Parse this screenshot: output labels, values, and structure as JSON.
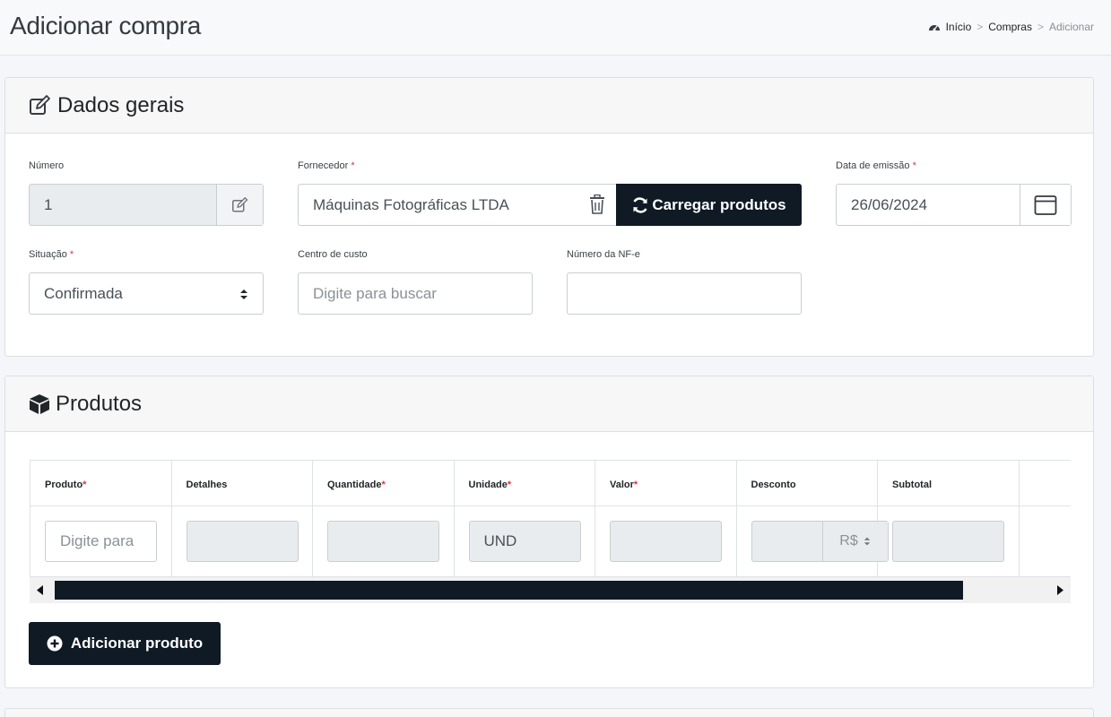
{
  "page": {
    "title": "Adicionar compra",
    "breadcrumb": {
      "home": "Início",
      "section": "Compras",
      "current": "Adicionar",
      "separator": ">"
    }
  },
  "general": {
    "title": "Dados gerais",
    "numero": {
      "label": "Número",
      "value": "1"
    },
    "fornecedor": {
      "label": "Fornecedor",
      "value": "Máquinas Fotográficas LTDA",
      "load_button": "Carregar produtos"
    },
    "data_emissao": {
      "label": "Data de emissão",
      "value": "26/06/2024"
    },
    "situacao": {
      "label": "Situação",
      "value": "Confirmada"
    },
    "centro_custo": {
      "label": "Centro de custo",
      "placeholder": "Digite para buscar"
    },
    "numero_nfe": {
      "label": "Número da NF-e",
      "value": ""
    },
    "required_mark": "*"
  },
  "products": {
    "title": "Produtos",
    "columns": {
      "produto": "Produto",
      "detalhes": "Detalhes",
      "quantidade": "Quantidade",
      "unidade": "Unidade",
      "valor": "Valor",
      "desconto": "Desconto",
      "subtotal": "Subtotal"
    },
    "row": {
      "produto_placeholder": "Digite para",
      "unidade": "UND",
      "desconto_currency": "R$"
    },
    "add_button": "Adicionar produto"
  },
  "colors": {
    "primary_dark": "#0f1a25",
    "required": "#dc3545",
    "readonly_bg": "#e9ecef"
  }
}
